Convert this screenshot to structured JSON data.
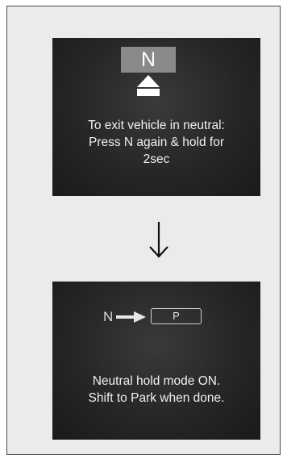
{
  "screen_1": {
    "gear_indicator": "N",
    "message_lines": [
      "To exit vehicle in neutral:",
      "Press N again & hold for",
      "2sec"
    ]
  },
  "transition_icon": "down-arrow-icon",
  "screen_2": {
    "from_gear": "N",
    "to_gear": "P",
    "message_lines": [
      "Neutral hold mode ON.",
      "Shift to Park when done."
    ]
  },
  "colors": {
    "screen_background": "#262626",
    "gear_box": "#8a8a8a",
    "text": "#f0f0f0",
    "frame_border": "#4a4a4a"
  }
}
